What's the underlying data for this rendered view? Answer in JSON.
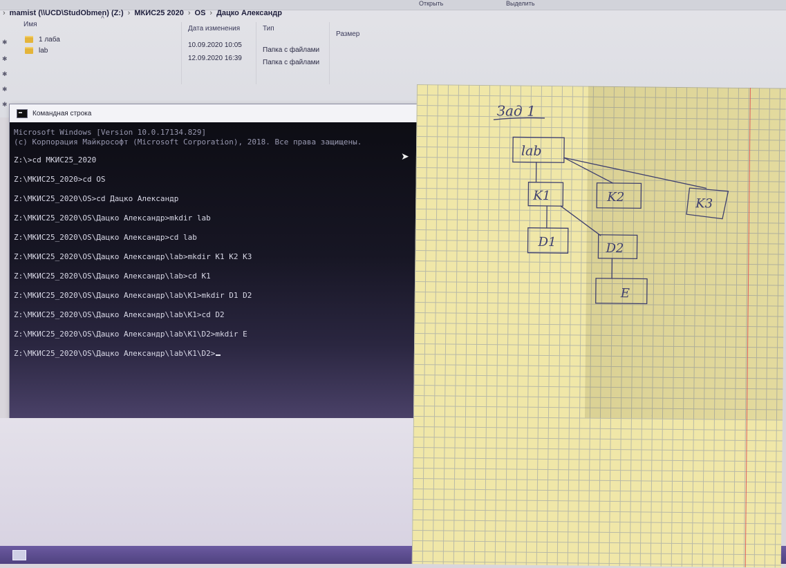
{
  "explorer": {
    "ribbon": {
      "open_label": "Открыть",
      "select_label": "Выделить"
    },
    "address": {
      "crumbs": [
        "mamist (\\\\UCD\\StudObmen) (Z:)",
        "МКИС25 2020",
        "OS",
        "Дацко Александр"
      ]
    },
    "columns": {
      "name": "Имя",
      "date": "Дата изменения",
      "type": "Тип",
      "size": "Размер"
    },
    "files": [
      {
        "name": "1 лаба",
        "date": "10.09.2020 10:05",
        "type": "Папка с файлами"
      },
      {
        "name": "lab",
        "date": "12.09.2020 16:39",
        "type": "Папка с файлами"
      }
    ]
  },
  "cmd": {
    "title": "Командная строка",
    "lines": [
      "Microsoft Windows [Version 10.0.17134.829]",
      "(c) Корпорация Майкрософт (Microsoft Corporation), 2018. Все права защищены.",
      "Z:\\>cd МКИС25_2020",
      "Z:\\МКИС25_2020>cd OS",
      "Z:\\МКИС25_2020\\OS>cd Дацко Александр",
      "Z:\\МКИС25_2020\\OS\\Дацко Александр>mkdir lab",
      "Z:\\МКИС25_2020\\OS\\Дацко Александр>cd lab",
      "Z:\\МКИС25_2020\\OS\\Дацко Александр\\lab>mkdir K1 K2 K3",
      "Z:\\МКИС25_2020\\OS\\Дацко Александр\\lab>cd K1",
      "Z:\\МКИС25_2020\\OS\\Дацко Александр\\lab\\K1>mkdir D1 D2",
      "Z:\\МКИС25_2020\\OS\\Дацко Александр\\lab\\K1>cd D2",
      "Z:\\МКИС25_2020\\OS\\Дацко Александр\\lab\\K1\\D2>mkdir E",
      "Z:\\МКИС25_2020\\OS\\Дацко Александр\\lab\\K1\\D2>"
    ]
  },
  "notebook": {
    "heading": "Зад 1",
    "nodes": {
      "root": "lab",
      "k1": "K1",
      "k2": "K2",
      "k3": "K3",
      "d1": "D1",
      "d2": "D2",
      "e": "E"
    },
    "ink_color": "#3e3f6e"
  }
}
